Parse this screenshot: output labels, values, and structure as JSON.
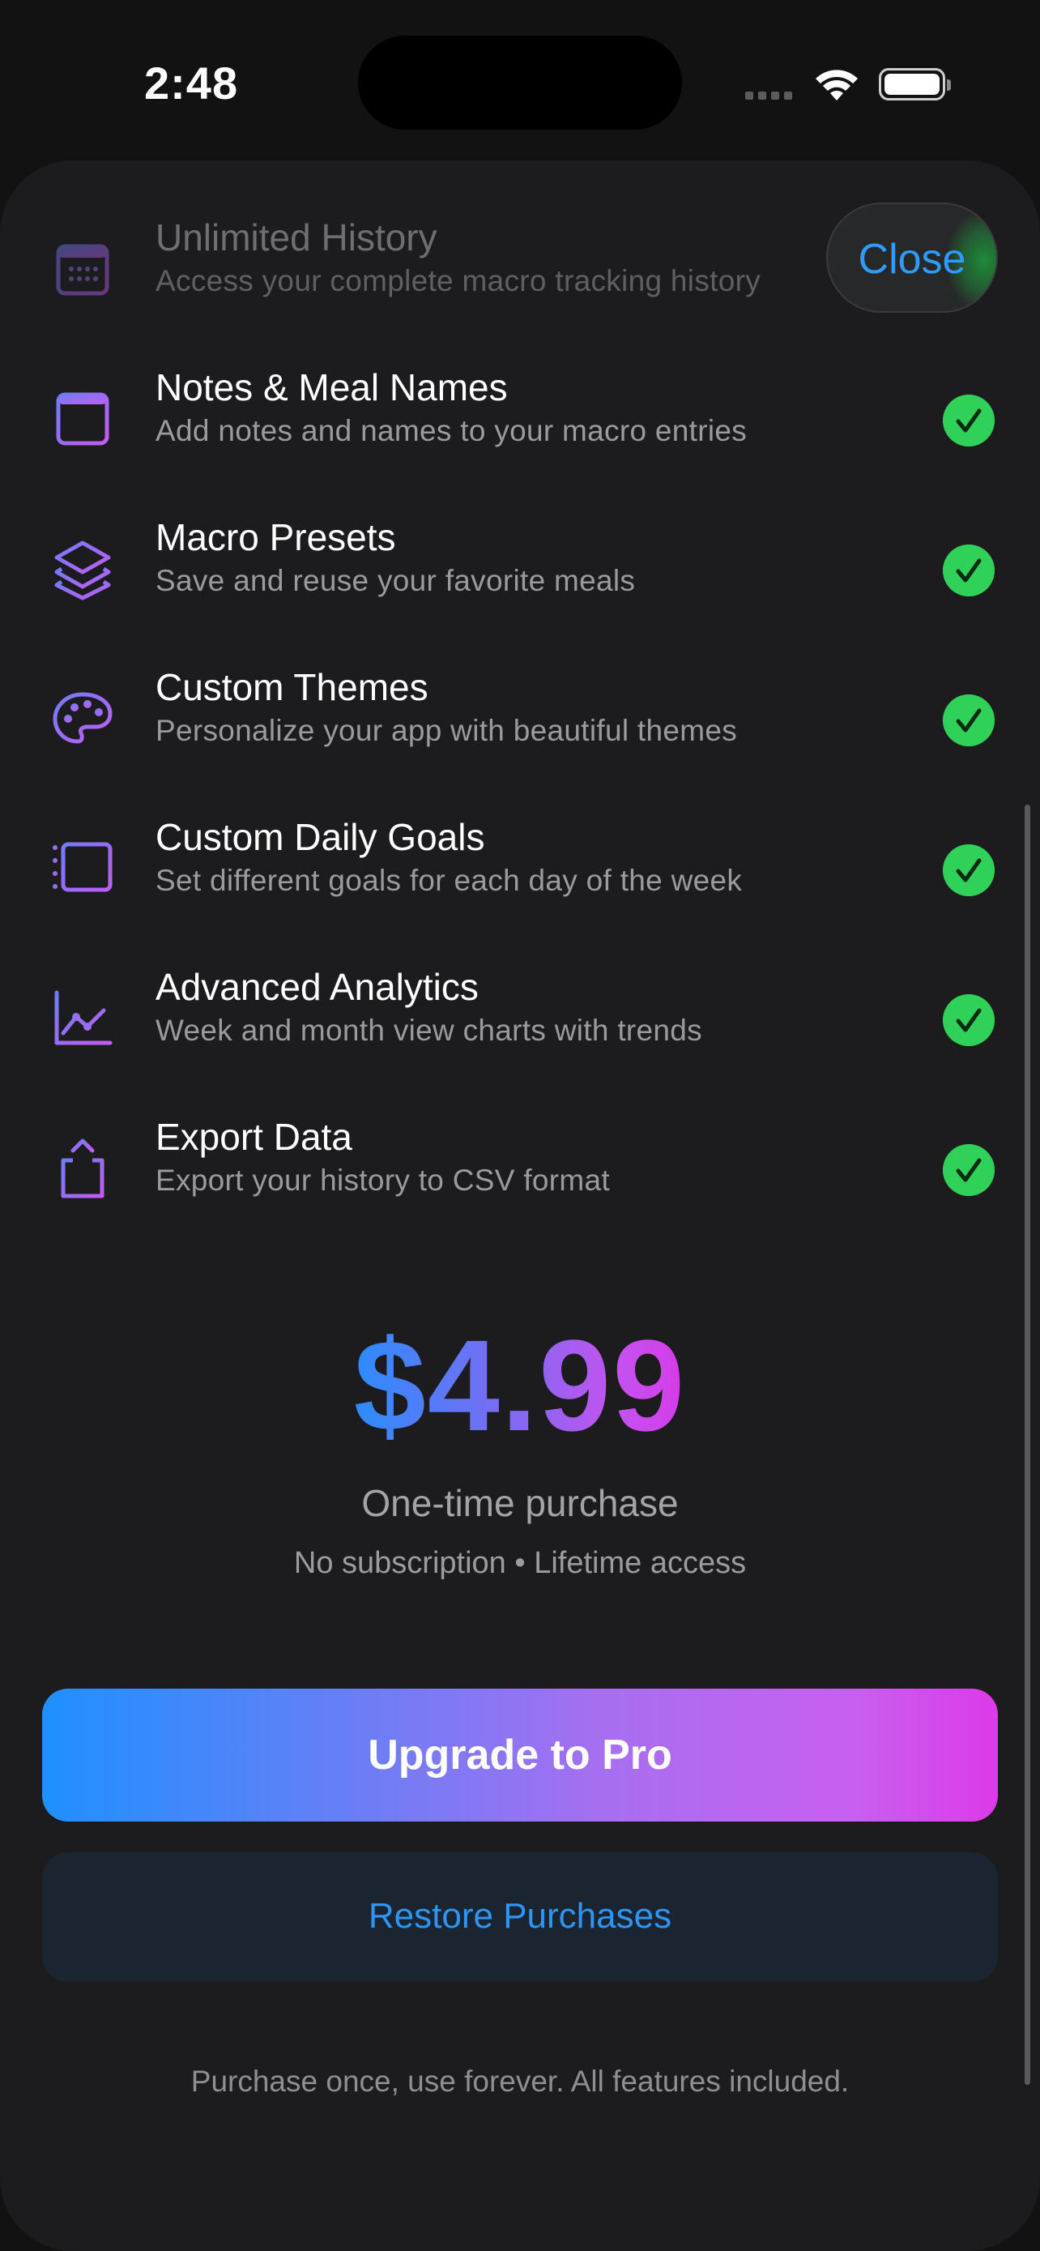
{
  "status_bar": {
    "time": "2:48"
  },
  "header": {
    "close_label": "Close"
  },
  "features": [
    {
      "title": "Unlimited History",
      "description": "Access your complete macro tracking history",
      "icon": "calendar-icon"
    },
    {
      "title": "Notes & Meal Names",
      "description": "Add notes and names to your macro entries",
      "icon": "notes-icon"
    },
    {
      "title": "Macro Presets",
      "description": "Save and reuse your favorite meals",
      "icon": "layers-icon"
    },
    {
      "title": "Custom Themes",
      "description": "Personalize your app with beautiful themes",
      "icon": "palette-icon"
    },
    {
      "title": "Custom Daily Goals",
      "description": "Set different goals for each day of the week",
      "icon": "list-icon"
    },
    {
      "title": "Advanced Analytics",
      "description": "Week and month view charts with trends",
      "icon": "chart-icon"
    },
    {
      "title": "Export Data",
      "description": "Export your history to CSV format",
      "icon": "share-icon"
    }
  ],
  "pricing": {
    "price": "$4.99",
    "purchase_type": "One-time purchase",
    "details": "No subscription • Lifetime access"
  },
  "actions": {
    "upgrade_label": "Upgrade to Pro",
    "restore_label": "Restore Purchases"
  },
  "footer": {
    "note": "Purchase once, use forever. All features included."
  },
  "colors": {
    "accent_blue": "#2e9bff",
    "check_green": "#30d158",
    "gradient_start": "#1e90ff",
    "gradient_end": "#dc3ae8",
    "icon_purple": "#9d6cf5"
  }
}
